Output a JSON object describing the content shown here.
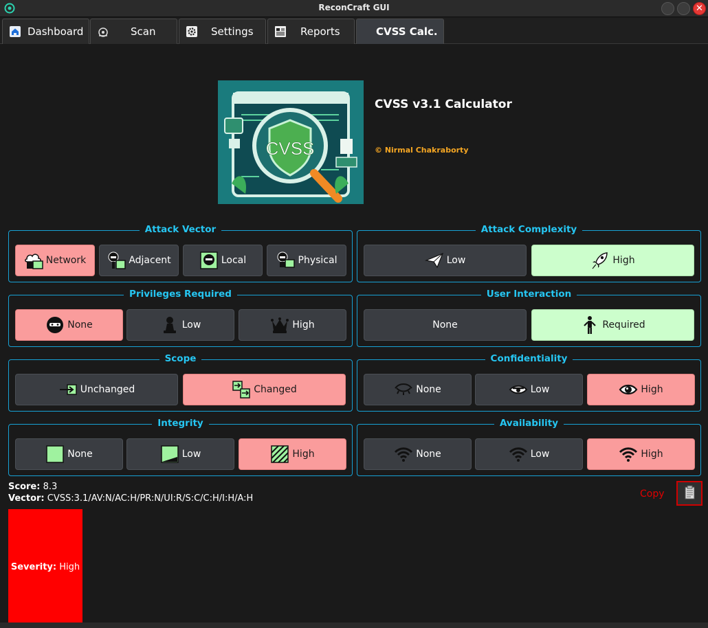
{
  "window": {
    "title": "ReconCraft GUI",
    "close_glyph": "✕"
  },
  "tabs": [
    {
      "label": "Dashboard",
      "icon": "home-icon"
    },
    {
      "label": "Scan",
      "icon": "radar-icon"
    },
    {
      "label": "Settings",
      "icon": "gear-icon"
    },
    {
      "label": "Reports",
      "icon": "report-icon"
    },
    {
      "label": "CVSS Calc.",
      "icon": ""
    }
  ],
  "header": {
    "title": "CVSS v3.1 Calculator",
    "author": "© Nirmal Chakraborty",
    "logo_text": "CVSS"
  },
  "groups": {
    "attack_vector": {
      "title": "Attack Vector",
      "options": [
        "Network",
        "Adjacent",
        "Local",
        "Physical"
      ],
      "selected": "Network"
    },
    "attack_complexity": {
      "title": "Attack Complexity",
      "options": [
        "Low",
        "High"
      ],
      "selected": "High"
    },
    "privileges_required": {
      "title": "Privileges Required",
      "options": [
        "None",
        "Low",
        "High"
      ],
      "selected": "None"
    },
    "user_interaction": {
      "title": "User Interaction",
      "options": [
        "None",
        "Required"
      ],
      "selected": "Required"
    },
    "scope": {
      "title": "Scope",
      "options": [
        "Unchanged",
        "Changed"
      ],
      "selected": "Changed"
    },
    "confidentiality": {
      "title": "Confidentiality",
      "options": [
        "None",
        "Low",
        "High"
      ],
      "selected": "High"
    },
    "integrity": {
      "title": "Integrity",
      "options": [
        "None",
        "Low",
        "High"
      ],
      "selected": "High"
    },
    "availability": {
      "title": "Availability",
      "options": [
        "None",
        "Low",
        "High"
      ],
      "selected": "High"
    }
  },
  "result": {
    "score_label": "Score:",
    "score_value": "8.3",
    "vector_label": "Vector:",
    "vector_value": "CVSS:3.1/AV:N/AC:H/PR:N/UI:R/S:C/C:H/I:H/A:H",
    "copy_label": "Copy",
    "severity_label": "Severity:",
    "severity_value": "High"
  },
  "colors": {
    "accent": "#26c6f2",
    "selected_red": "#fa9c9c",
    "selected_green": "#ccfecc",
    "severity_high": "#ff0000",
    "author": "#f5a623"
  }
}
